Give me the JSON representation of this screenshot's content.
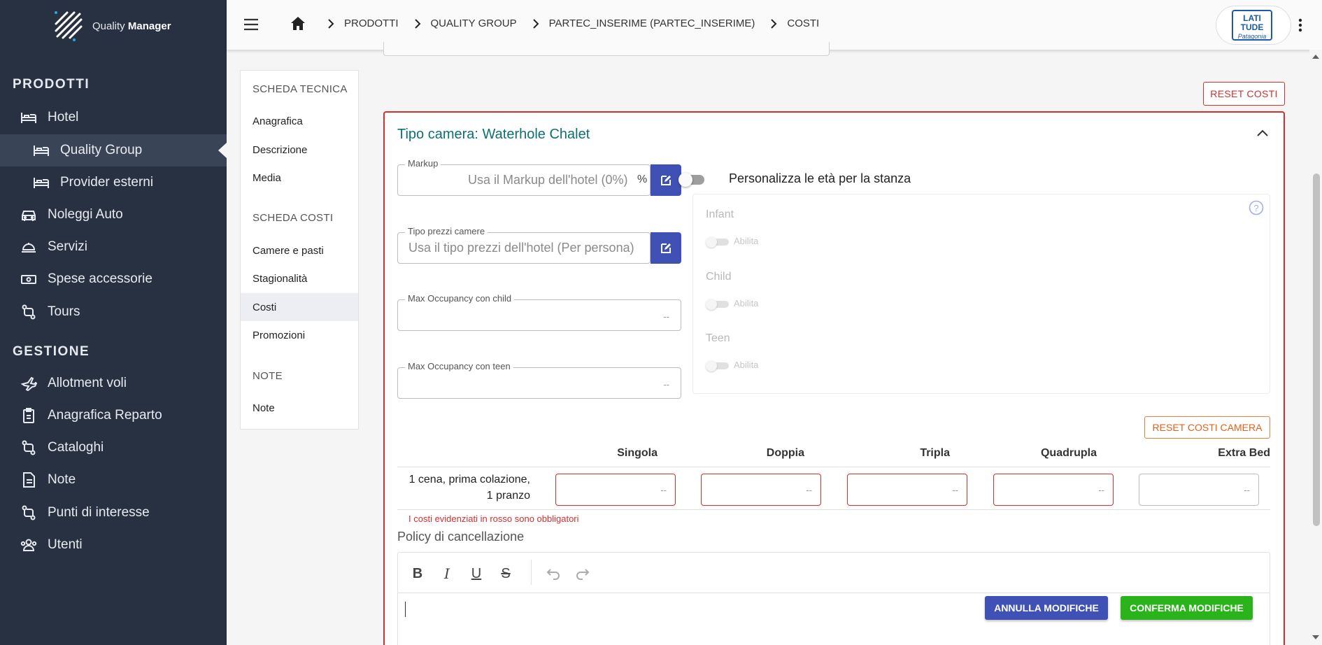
{
  "app": {
    "logo_prefix": "Quality",
    "logo_suffix": "Manager"
  },
  "sidebar": {
    "sections": [
      {
        "label": "PRODOTTI"
      },
      {
        "label": "GESTIONE"
      }
    ],
    "items": [
      {
        "label": "Hotel",
        "icon": "bed-icon"
      },
      {
        "label": "Quality Group",
        "icon": "bed-icon",
        "active": true
      },
      {
        "label": "Provider esterni",
        "icon": "bed-icon"
      },
      {
        "label": "Noleggi Auto",
        "icon": "car-icon"
      },
      {
        "label": "Servizi",
        "icon": "service-bell-icon"
      },
      {
        "label": "Spese accessorie",
        "icon": "money-icon"
      },
      {
        "label": "Tours",
        "icon": "route-icon"
      },
      {
        "label": "Allotment voli",
        "icon": "airplane-icon"
      },
      {
        "label": "Anagrafica Reparto",
        "icon": "badge-icon"
      },
      {
        "label": "Cataloghi",
        "icon": "route-icon"
      },
      {
        "label": "Note",
        "icon": "note-icon"
      },
      {
        "label": "Punti di interesse",
        "icon": "route-icon"
      },
      {
        "label": "Utenti",
        "icon": "users-icon"
      }
    ]
  },
  "header": {
    "breadcrumbs": [
      "PRODOTTI",
      "QUALITY GROUP",
      "PARTEC_INSERIME (PARTEC_INSERIME)",
      "COSTI"
    ],
    "brand_logo_text": "LATI TUDE",
    "brand_logo_sub": "Patagonia"
  },
  "subnav": {
    "sections": [
      "SCHEDA TECNICA",
      "SCHEDA COSTI",
      "NOTE"
    ],
    "items": [
      "Anagrafica",
      "Descrizione",
      "Media",
      "Camere e pasti",
      "Stagionalità",
      "Costi",
      "Promozioni",
      "Note"
    ],
    "active": "Costi"
  },
  "reset_costi_label": "RESET COSTI",
  "room": {
    "title": "Tipo camera: Waterhole Chalet",
    "markup": {
      "label": "Markup",
      "value": "Usa il Markup dell'hotel (0%)",
      "suffix": "%"
    },
    "tipo_prezzi": {
      "label": "Tipo prezzi camere",
      "value": "Usa il tipo prezzi dell'hotel (Per persona)"
    },
    "max_child": {
      "label": "Max Occupancy con child",
      "value": "--"
    },
    "max_teen": {
      "label": "Max Occupancy con teen",
      "value": "--"
    },
    "personalizza_label": "Personalizza le età per la stanza",
    "ages": [
      {
        "title": "Infant",
        "toggle": "Abilita"
      },
      {
        "title": "Child",
        "toggle": "Abilita"
      },
      {
        "title": "Teen",
        "toggle": "Abilita"
      }
    ],
    "reset_camera_label": "RESET COSTI CAMERA",
    "columns": [
      "Singola",
      "Doppia",
      "Tripla",
      "Quadrupla",
      "Extra Bed"
    ],
    "row": {
      "label_line1": "1 cena, prima colazione,",
      "label_line2": "1 pranzo",
      "values": [
        "--",
        "--",
        "--",
        "--",
        "--"
      ]
    },
    "required_note": "I costi evidenziati in rosso sono obbligatori",
    "policy_title": "Policy di cancellazione",
    "editor_tools": [
      "B",
      "I",
      "U",
      "S"
    ],
    "annulla_label": "ANNULLA MODIFICHE",
    "conferma_label": "CONFERMA MODIFICHE"
  },
  "colors": {
    "sidebar_bg": "#283142",
    "primary": "#3f51b5",
    "danger": "#d32f2f",
    "success": "#2bb31c",
    "title_teal": "#0e6f73"
  }
}
